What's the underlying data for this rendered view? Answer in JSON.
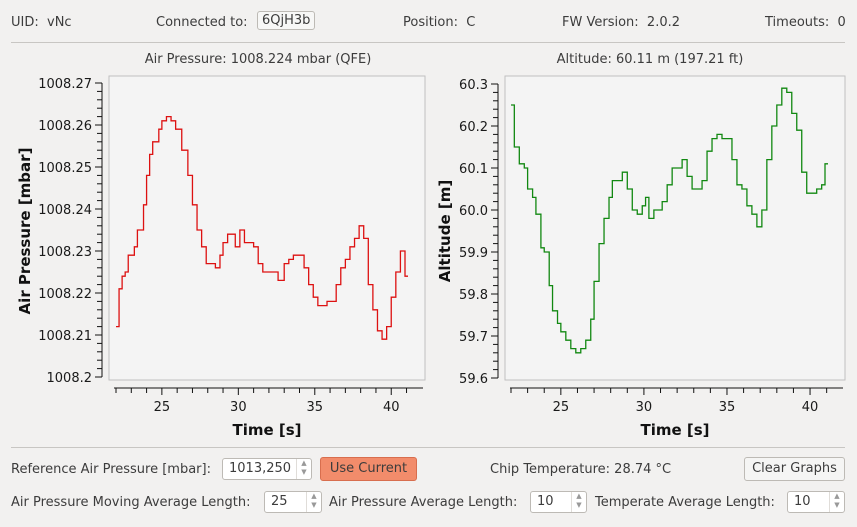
{
  "header": {
    "uid_label": "UID:",
    "uid_value": "vNc",
    "connected_label": "Connected to:",
    "connected_value": "6QjH3b",
    "position_label": "Position:",
    "position_value": "C",
    "fw_label": "FW Version:",
    "fw_value": "2.0.2",
    "timeouts_label": "Timeouts:",
    "timeouts_value": "0"
  },
  "readouts": {
    "air_pressure": "Air Pressure: 1008.224 mbar (QFE)",
    "altitude": "Altitude: 60.11 m (197.21 ft)",
    "chip_temperature": "Chip Temperature: 28.74 °C"
  },
  "controls": {
    "reference_label": "Reference Air Pressure [mbar]:",
    "reference_value": "1013,250",
    "use_current_label": "Use Current",
    "clear_graphs_label": "Clear Graphs",
    "moving_avg_label": "Air Pressure Moving Average Length:",
    "moving_avg_value": "25",
    "pressure_avg_label": "Air Pressure Average Length:",
    "pressure_avg_value": "10",
    "temperature_avg_label": "Temperate Average Length:",
    "temperature_avg_value": "10",
    "accent_color": "#f28c6b"
  },
  "chart_data": [
    {
      "type": "line",
      "title": "Air Pressure: 1008.224 mbar (QFE)",
      "xlabel": "Time [s]",
      "ylabel": "Air Pressure [mbar]",
      "xlim": [
        22,
        42
      ],
      "ylim": [
        1008.2,
        1008.27
      ],
      "xticks": [
        25,
        30,
        35,
        40
      ],
      "yticks": [
        "1008.2",
        "1008.21",
        "1008.22",
        "1008.23",
        "1008.24",
        "1008.25",
        "1008.26",
        "1008.27"
      ],
      "color": "#dd1111",
      "step": true,
      "series": [
        {
          "name": "Air Pressure",
          "x": [
            22.0,
            22.2,
            22.4,
            22.6,
            22.8,
            23.2,
            23.4,
            23.8,
            24.0,
            24.2,
            24.4,
            24.8,
            25.0,
            25.3,
            25.6,
            25.9,
            26.3,
            26.7,
            27.0,
            27.3,
            27.6,
            27.9,
            28.2,
            28.5,
            28.8,
            29.0,
            29.3,
            29.5,
            29.8,
            30.1,
            30.4,
            30.7,
            31.0,
            31.3,
            31.6,
            31.9,
            32.3,
            32.6,
            33.0,
            33.3,
            33.6,
            34.0,
            34.3,
            34.6,
            34.9,
            35.2,
            35.5,
            35.8,
            36.1,
            36.4,
            36.7,
            37.0,
            37.3,
            37.6,
            37.9,
            38.2,
            38.5,
            38.8,
            39.1,
            39.4,
            39.7,
            40.0,
            40.3,
            40.6,
            40.9
          ],
          "y": [
            1008.212,
            1008.221,
            1008.224,
            1008.225,
            1008.229,
            1008.231,
            1008.235,
            1008.241,
            1008.248,
            1008.253,
            1008.256,
            1008.259,
            1008.261,
            1008.262,
            1008.261,
            1008.259,
            1008.254,
            1008.248,
            1008.241,
            1008.235,
            1008.231,
            1008.227,
            1008.227,
            1008.226,
            1008.229,
            1008.232,
            1008.234,
            1008.234,
            1008.231,
            1008.235,
            1008.232,
            1008.232,
            1008.231,
            1008.227,
            1008.225,
            1008.225,
            1008.225,
            1008.223,
            1008.227,
            1008.228,
            1008.229,
            1008.229,
            1008.226,
            1008.222,
            1008.219,
            1008.217,
            1008.217,
            1008.218,
            1008.218,
            1008.222,
            1008.226,
            1008.228,
            1008.231,
            1008.233,
            1008.236,
            1008.233,
            1008.222,
            1008.216,
            1008.211,
            1008.209,
            1008.212,
            1008.219,
            1008.225,
            1008.23,
            1008.224
          ]
        }
      ]
    },
    {
      "type": "line",
      "title": "Altitude: 60.11 m (197.21 ft)",
      "xlabel": "Time [s]",
      "ylabel": "Altitude [m]",
      "xlim": [
        22,
        42
      ],
      "ylim": [
        59.6,
        60.3
      ],
      "xticks": [
        25,
        30,
        35,
        40
      ],
      "yticks": [
        "59.6",
        "59.7",
        "59.8",
        "59.9",
        "60.0",
        "60.1",
        "60.2",
        "60.3"
      ],
      "color": "#118811",
      "step": true,
      "series": [
        {
          "name": "Altitude",
          "x": [
            22.0,
            22.2,
            22.5,
            22.8,
            23.0,
            23.3,
            23.5,
            23.8,
            24.0,
            24.3,
            24.5,
            24.8,
            25.0,
            25.3,
            25.6,
            25.9,
            26.2,
            26.5,
            26.8,
            27.0,
            27.3,
            27.6,
            27.9,
            28.1,
            28.4,
            28.7,
            29.0,
            29.3,
            29.6,
            29.9,
            30.1,
            30.3,
            30.6,
            30.9,
            31.1,
            31.4,
            31.7,
            32.0,
            32.3,
            32.6,
            32.9,
            33.2,
            33.5,
            33.8,
            34.1,
            34.4,
            34.7,
            35.0,
            35.3,
            35.6,
            35.9,
            36.2,
            36.5,
            36.8,
            37.1,
            37.4,
            37.7,
            38.0,
            38.3,
            38.6,
            38.9,
            39.2,
            39.5,
            39.8,
            40.1,
            40.4,
            40.7,
            40.9
          ],
          "y": [
            60.25,
            60.15,
            60.11,
            60.1,
            60.05,
            60.03,
            59.99,
            59.91,
            59.9,
            59.82,
            59.76,
            59.73,
            59.71,
            59.69,
            59.67,
            59.66,
            59.67,
            59.69,
            59.74,
            59.83,
            59.92,
            59.98,
            60.03,
            60.07,
            60.07,
            60.09,
            60.05,
            60.0,
            59.99,
            60.01,
            60.03,
            59.98,
            60.0,
            60.0,
            60.02,
            60.06,
            60.1,
            60.1,
            60.12,
            60.08,
            60.05,
            60.05,
            60.07,
            60.14,
            60.17,
            60.18,
            60.17,
            60.17,
            60.12,
            60.06,
            60.05,
            60.01,
            59.99,
            59.96,
            60.0,
            60.12,
            60.2,
            60.25,
            60.29,
            60.28,
            60.23,
            60.19,
            60.09,
            60.04,
            60.04,
            60.05,
            60.06,
            60.11
          ]
        }
      ]
    }
  ]
}
